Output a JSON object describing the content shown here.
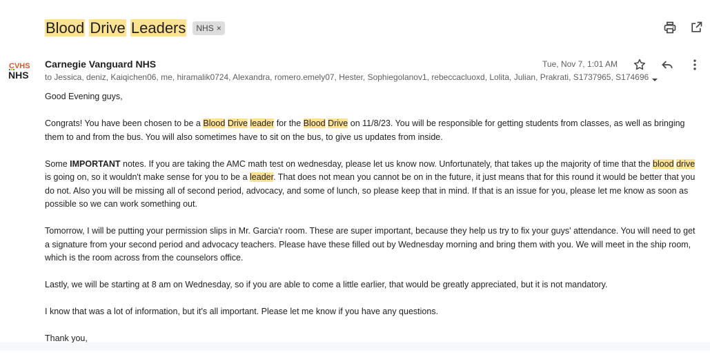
{
  "subject": {
    "words": [
      "Blood",
      "Drive",
      "Leaders"
    ],
    "label_chip": "NHS",
    "label_remove": "×"
  },
  "toolbar": {
    "icons": [
      "print-icon",
      "open-in-new-window-icon"
    ]
  },
  "avatar": {
    "top_text": "CVHS",
    "bottom_text": "NHS"
  },
  "message": {
    "sender": "Carnegie Vanguard NHS",
    "date": "Tue, Nov 7, 1:01 AM",
    "to": "to Jessica, deniz, Kaiqichen06, me, hiramalik0724, Alexandra, romero.emely07, Hester, Sophiegolanov1, rebeccacluoxd, Lolita, Julian, Prakrati, S1737965, S174696",
    "icons": [
      "star-icon",
      "reply-icon",
      "more-vert-icon"
    ]
  },
  "body": {
    "greeting": "Good Evening guys,",
    "p1": {
      "a": "Congrats! You have been chosen to be a ",
      "h1": "Blood",
      "s1": " ",
      "h2": "Drive",
      "s2": " ",
      "h3": "leader",
      "b": " for the ",
      "h4": "Blood",
      "s3": " ",
      "h5": "Drive",
      "c": " on 11/8/23. You will be responsible for getting students from classes, as well as bringing them to and from the bus. You will also sometimes have to sit on the bus, to give us updates from inside."
    },
    "p2": {
      "a": "Some ",
      "bold": "IMPORTANT",
      "b": " notes. If you are taking the AMC math test on wednesday, please let us know now. Unfortunately, that takes up the majority of time that the ",
      "h1": "blood",
      "s1": " ",
      "h2": "drive",
      "c": " is going on, so it wouldn't make sense for you to be a ",
      "h3": "leader",
      "d": ". That does not mean you cannot be on in the future, it just means that for this round it would be better that you do not. Also you will be missing all of second period, advocacy, and some of lunch, so please keep that in mind. If that is an issue for you, please let me know as soon as possible so we can work something out."
    },
    "p3": "Tomorrow, I will be putting your permission slips in Mr. Garcia'r room. These are super important, because they help us try to fix your guys' attendance. You will need to get a signature from your second period and advocacy teachers. Please have these filled out by Wednesday morning and bring them with you. We will meet in the ship room, which is the room across from the counselors office.",
    "p4": "Lastly, we will be starting at 8 am on Wednesday, so if you are able to come a little earlier, that would be greatly appreciated, but it is not mandatory.",
    "p5": "I know that was a lot of information, but it's all important. Please let me know if you have any questions.",
    "closing": "Thank you,"
  },
  "colors": {
    "highlight": "#fde293",
    "chip_bg": "#dddddd",
    "text": "#222222",
    "muted": "#5e5e5e"
  }
}
